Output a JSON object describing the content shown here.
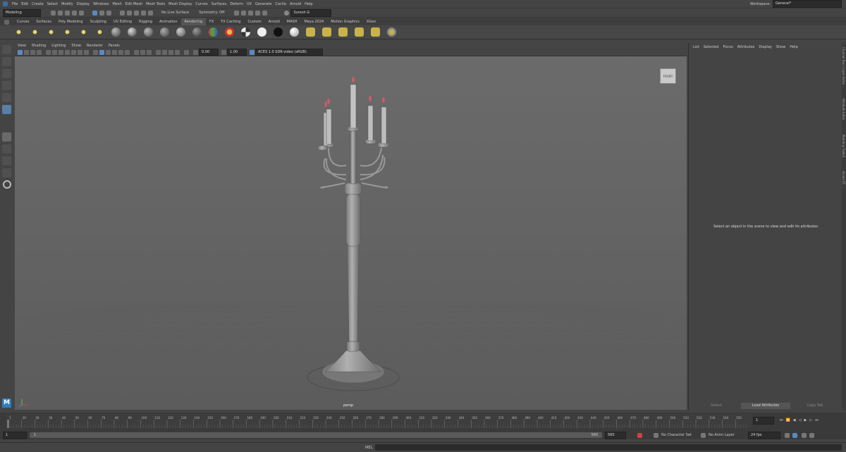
{
  "menubar": {
    "items": [
      "File",
      "Edit",
      "Create",
      "Select",
      "Modify",
      "Display",
      "Windows",
      "Mesh",
      "Edit Mesh",
      "Mesh Tools",
      "Mesh Display",
      "Curves",
      "Surfaces",
      "Deform",
      "UV",
      "Generate",
      "Cache",
      "Arnold",
      "Help"
    ],
    "workspace_label": "Workspace:",
    "workspace_value": "General*"
  },
  "statusline": {
    "mode": "Modeling",
    "live_surface": "No Live Surface",
    "symmetry": "Symmetry: Off",
    "user": "Suresh G"
  },
  "shelf": {
    "tabs": [
      "Curves",
      "Surfaces",
      "Poly Modeling",
      "Sculpting",
      "UV Editing",
      "Rigging",
      "Animation",
      "Rendering",
      "FX",
      "FX Caching",
      "Custom",
      "Arnold",
      "MASH",
      "Maya 2024",
      "Motion Graphics",
      "XGen"
    ],
    "active_tab": "Rendering"
  },
  "panel": {
    "menus": [
      "View",
      "Shading",
      "Lighting",
      "Show",
      "Renderer",
      "Panels"
    ],
    "field_a": "0.00",
    "field_b": "1.00",
    "color_space": "ACES 1.0 SDR-video (sRGB)"
  },
  "viewport": {
    "camera_label": "persp",
    "view_cube": "FRONT"
  },
  "attr_editor": {
    "menus": [
      "List",
      "Selected",
      "Focus",
      "Attributes",
      "Display",
      "Show",
      "Help"
    ],
    "message": "Select an object in the scene to view and edit its attributes",
    "btn_select": "Select",
    "btn_load": "Load Attributes",
    "btn_copy": "Copy Tab"
  },
  "side_tabs": [
    "Channel Box / Layer Editor",
    "Attribute Editor",
    "Modeling Toolkit",
    "Arnold RT"
  ],
  "timeline": {
    "ticks": [
      "1",
      "10",
      "20",
      "30",
      "40",
      "50",
      "60",
      "70",
      "80",
      "90",
      "100",
      "110",
      "120",
      "130",
      "140",
      "150",
      "160",
      "170",
      "180",
      "190",
      "200",
      "210",
      "220",
      "230",
      "240",
      "250",
      "260",
      "270",
      "280",
      "290",
      "300",
      "310",
      "320",
      "330",
      "340",
      "350",
      "360",
      "370",
      "380",
      "390",
      "400",
      "410",
      "420",
      "430",
      "440",
      "450",
      "460",
      "470",
      "480",
      "490",
      "500",
      "510",
      "520",
      "530",
      "540",
      "550"
    ],
    "current_frame": "1"
  },
  "range": {
    "start": "1",
    "inner_start": "1",
    "inner_end": "560",
    "end": "560",
    "character_set": "No Character Set",
    "anim_layer": "No Anim Layer",
    "fps": "24 fps"
  },
  "command_line": {
    "lang": "MEL"
  },
  "colors": {
    "candle_flame": "#d45a6a",
    "accent": "#5a9bd4",
    "grid": "#5d5d5d"
  }
}
